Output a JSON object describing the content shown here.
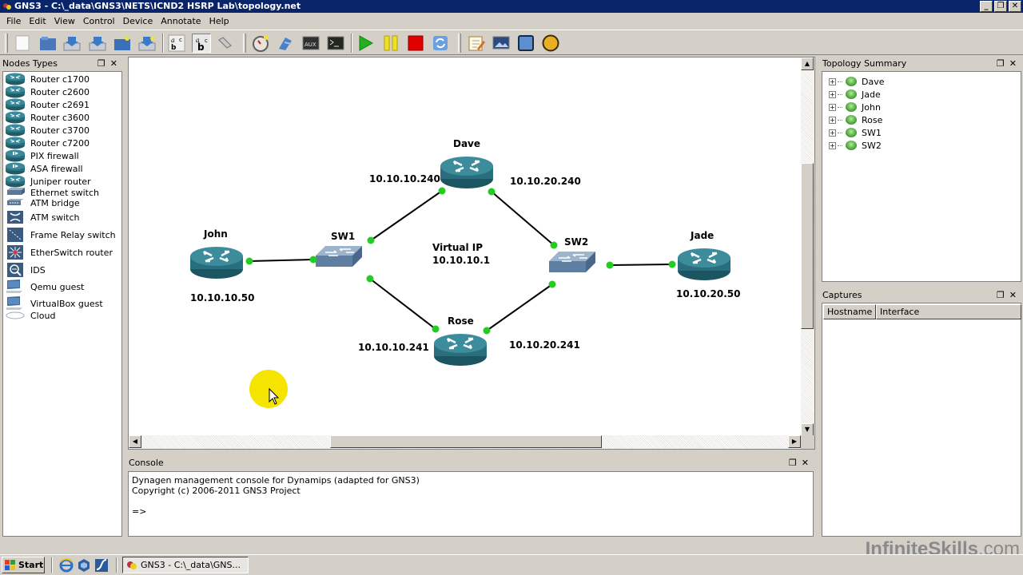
{
  "window": {
    "title": "GNS3 - C:\\_data\\GNS3\\NETS\\ICND2 HSRP Lab\\topology.net",
    "controls": [
      "_",
      "❐",
      "✕"
    ]
  },
  "menu": [
    "File",
    "Edit",
    "View",
    "Control",
    "Device",
    "Annotate",
    "Help"
  ],
  "toolbar": {
    "buttons": [
      "new-blank-topology",
      "open",
      "save",
      "save-as",
      "open-project",
      "save-project",
      "show-interface-labels",
      "show-hostnames",
      "add-link",
      "idle-pc",
      "console-to-all",
      "aux-to-all",
      "console",
      "start-all",
      "suspend-all",
      "stop-all",
      "reload-all",
      "add-note",
      "insert-picture",
      "draw-rectangle",
      "draw-ellipse"
    ],
    "aux_label": "AUX"
  },
  "nodes_panel": {
    "title": "Nodes Types",
    "items": [
      {
        "label": "Router c1700",
        "icon": "router"
      },
      {
        "label": "Router c2600",
        "icon": "router"
      },
      {
        "label": "Router c2691",
        "icon": "router"
      },
      {
        "label": "Router c3600",
        "icon": "router"
      },
      {
        "label": "Router c3700",
        "icon": "router"
      },
      {
        "label": "Router c7200",
        "icon": "router"
      },
      {
        "label": "PIX firewall",
        "icon": "firewall"
      },
      {
        "label": "ASA firewall",
        "icon": "firewall"
      },
      {
        "label": "Juniper router",
        "icon": "router"
      },
      {
        "label": "Ethernet switch",
        "icon": "switch"
      },
      {
        "label": "ATM bridge",
        "icon": "atm-bridge"
      },
      {
        "label": "ATM switch",
        "icon": "atm-switch"
      },
      {
        "label": "Frame Relay switch",
        "icon": "frame-relay"
      },
      {
        "label": "EtherSwitch router",
        "icon": "etherswitch"
      },
      {
        "label": "IDS",
        "icon": "ids"
      },
      {
        "label": "Qemu guest",
        "icon": "computer"
      },
      {
        "label": "VirtualBox guest",
        "icon": "computer"
      },
      {
        "label": "Cloud",
        "icon": "cloud"
      }
    ]
  },
  "topology": {
    "devices": [
      {
        "name": "John",
        "type": "router",
        "ip": "10.10.10.50"
      },
      {
        "name": "SW1",
        "type": "switch"
      },
      {
        "name": "Dave",
        "type": "router",
        "ip_left": "10.10.10.240",
        "ip_right": "10.10.20.240"
      },
      {
        "name": "Rose",
        "type": "router",
        "ip_left": "10.10.10.241",
        "ip_right": "10.10.20.241"
      },
      {
        "name": "SW2",
        "type": "switch"
      },
      {
        "name": "Jade",
        "type": "router",
        "ip": "10.10.20.50"
      }
    ],
    "links": [
      [
        "John",
        "SW1"
      ],
      [
        "SW1",
        "Dave"
      ],
      [
        "SW1",
        "Rose"
      ],
      [
        "Dave",
        "SW2"
      ],
      [
        "Rose",
        "SW2"
      ],
      [
        "SW2",
        "Jade"
      ]
    ],
    "annotation": {
      "line1": "Virtual IP",
      "line2": "10.10.10.1"
    },
    "link_status_color": "#22cc22"
  },
  "topology_summary": {
    "title": "Topology Summary",
    "items": [
      "Dave",
      "Jade",
      "John",
      "Rose",
      "SW1",
      "SW2"
    ],
    "status_color": "#4aa83a"
  },
  "captures": {
    "title": "Captures",
    "columns": [
      "Hostname",
      "Interface"
    ]
  },
  "console": {
    "title": "Console",
    "lines": [
      "Dynagen management console for Dynamips (adapted for GNS3)",
      "Copyright (c) 2006-2011 GNS3 Project",
      "",
      "=>"
    ]
  },
  "taskbar": {
    "start_label": "Start",
    "quicklaunch": [
      "internet-explorer",
      "virtualbox",
      "wireshark"
    ],
    "task_label": "GNS3 - C:\\_data\\GNS..."
  },
  "watermark": {
    "brand": "InfiniteSkills",
    "suffix": ".com"
  }
}
